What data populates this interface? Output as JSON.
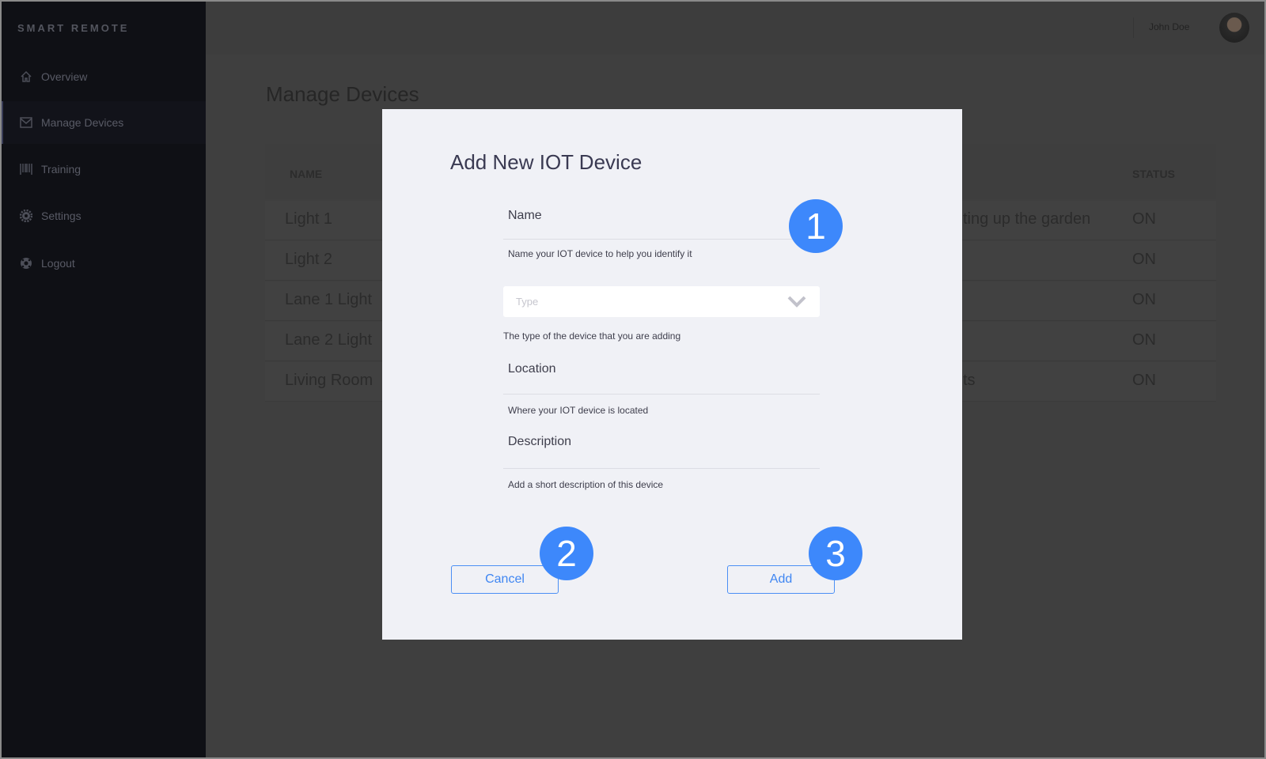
{
  "sidebar": {
    "brand": "SMART REMOTE",
    "items": [
      {
        "label": "Overview",
        "icon": "home-icon"
      },
      {
        "label": "Manage Devices",
        "icon": "mail-icon",
        "active": true
      },
      {
        "label": "Training",
        "icon": "barcode-icon"
      },
      {
        "label": "Settings",
        "icon": "gear-icon"
      },
      {
        "label": "Logout",
        "icon": "lifebuoy-icon"
      }
    ]
  },
  "header": {
    "user_name": "John Doe"
  },
  "page": {
    "title": "Manage Devices"
  },
  "table": {
    "columns": {
      "name": "NAME",
      "status": "STATUS"
    },
    "rows": [
      {
        "name": "Light 1",
        "description": "ting up the garden",
        "status": "ON"
      },
      {
        "name": "Light 2",
        "description": "",
        "status": "ON"
      },
      {
        "name": "Lane 1 Light",
        "description": "",
        "status": "ON"
      },
      {
        "name": "Lane 2 Light",
        "description": "",
        "status": "ON"
      },
      {
        "name": "Living Room",
        "description": "ts",
        "status": "ON"
      }
    ]
  },
  "modal": {
    "title": "Add New IOT Device",
    "name": {
      "placeholder": "Name",
      "help": "Name your IOT device to help you identify it"
    },
    "type": {
      "placeholder": "Type",
      "help": "The type of the device that you are adding"
    },
    "location": {
      "placeholder": "Location",
      "help": "Where your IOT device is located"
    },
    "description": {
      "placeholder": "Description",
      "help": "Add a short description of this device"
    },
    "cancel_label": "Cancel",
    "add_label": "Add"
  },
  "annotations": [
    "1",
    "2",
    "3"
  ],
  "colors": {
    "accent": "#3d88fb",
    "sidebar": "#0f1015",
    "modal": "#f0f1f6"
  }
}
